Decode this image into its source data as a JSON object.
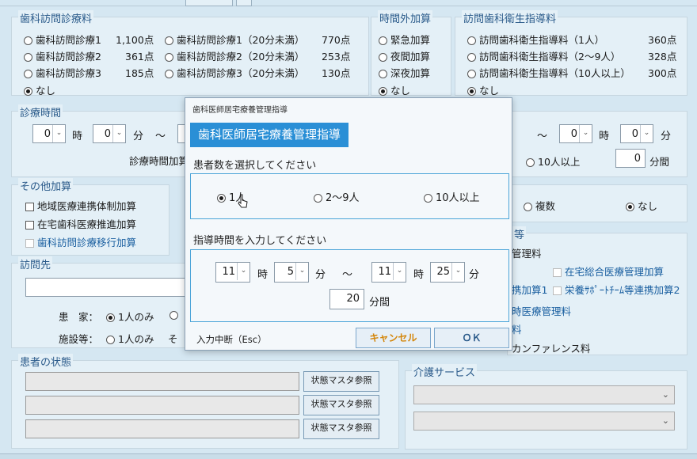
{
  "visit_fee": {
    "legend": "歯科訪問診療料",
    "col1": [
      {
        "label": "歯科訪問診療1",
        "pts": "1,100点"
      },
      {
        "label": "歯科訪問診療2",
        "pts": "361点"
      },
      {
        "label": "歯科訪問診療3",
        "pts": "185点"
      },
      {
        "label": "なし",
        "pts": ""
      }
    ],
    "col2": [
      {
        "label": "歯科訪問診療1（20分未満）",
        "pts": "770点"
      },
      {
        "label": "歯科訪問診療2（20分未満）",
        "pts": "253点"
      },
      {
        "label": "歯科訪問診療3（20分未満）",
        "pts": "130点"
      }
    ],
    "selected": "なし"
  },
  "overtime": {
    "legend": "時間外加算",
    "options": [
      "緊急加算",
      "夜間加算",
      "深夜加算",
      "なし"
    ],
    "selected": "なし"
  },
  "hygiene": {
    "legend": "訪問歯科衛生指導料",
    "options": [
      {
        "label": "訪問歯科衛生指導料（1人）",
        "pts": "360点"
      },
      {
        "label": "訪問歯科衛生指導料（2〜9人）",
        "pts": "328点"
      },
      {
        "label": "訪問歯科衛生指導料（10人以上）",
        "pts": "300点"
      },
      {
        "label": "なし",
        "pts": ""
      }
    ],
    "selected": "なし"
  },
  "consult_time": {
    "legend": "診療時間",
    "hour": "0",
    "min": "0",
    "hour_unit": "時",
    "min_unit": "分",
    "tilde": "〜",
    "add_label": "診療時間加算",
    "right_hour": "0",
    "right_min": "0",
    "ten_plus": "10人以上",
    "minutes_val": "0",
    "minutes_unit": "分間"
  },
  "other_add": {
    "legend": "その他加算",
    "items": [
      "地域医療連携体制加算",
      "在宅歯科医療推進加算",
      "歯科訪問診療移行加算"
    ]
  },
  "right_mid": {
    "multi": "複数",
    "none": "なし",
    "legend_frag": "等",
    "line1": "管理料",
    "cb1": "在宅総合医療管理加算",
    "cb2_pre": "携加算1",
    "cb2": "栄養ｻﾎﾟｰﾄﾁｰﾑ等連携加算2",
    "line3": "時医療管理料",
    "line4": "料",
    "line5": "カンファレンス料"
  },
  "visit_dest": {
    "legend": "訪問先",
    "patient_label": "患　家：",
    "patient_opt": "1人のみ",
    "facility_label": "施設等：",
    "facility_opt": "1人のみ",
    "frag": "そ"
  },
  "patient_state": {
    "legend": "患者の状態",
    "button": "状態マスタ参照"
  },
  "care": {
    "legend": "介護サービス"
  },
  "dialog": {
    "title": "歯科医師居宅療養管理指導",
    "heading": "歯科医師居宅療養管理指導",
    "count_prompt": "患者数を選択してください",
    "count_options": [
      "1人",
      "2〜9人",
      "10人以上"
    ],
    "count_selected": "1人",
    "time_prompt": "指導時間を入力してください",
    "start_hour": "11",
    "start_min": "5",
    "end_hour": "11",
    "end_min": "25",
    "hour_unit": "時",
    "min_unit": "分",
    "tilde": "〜",
    "duration": "20",
    "duration_unit": "分間",
    "abort_hint": "入力中断（Esc）",
    "cancel": "キャンセル",
    "ok": "ＯＫ"
  }
}
